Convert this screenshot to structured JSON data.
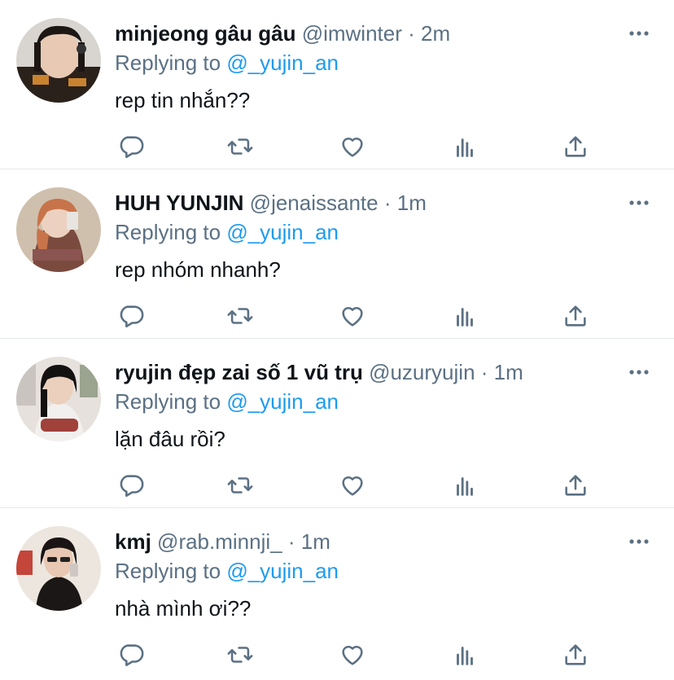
{
  "colors": {
    "accent": "#1d9bf0",
    "muted": "#5b7083",
    "text": "#0f1419",
    "divider": "#e6e9eb"
  },
  "icons": [
    "reply-icon",
    "retweet-icon",
    "like-icon",
    "analytics-icon",
    "share-icon",
    "more-icon"
  ],
  "tweets": [
    {
      "name": "minjeong gâu gâu",
      "handle": "@imwinter",
      "separator": "·",
      "time": "2m",
      "replying_prefix": "Replying to",
      "replying_to": "@_yujin_an",
      "text": "rep tin nhắn??"
    },
    {
      "name": "HUH YUNJIN",
      "handle": "@jenaissante",
      "separator": "·",
      "time": "1m",
      "replying_prefix": "Replying to",
      "replying_to": "@_yujin_an",
      "text": "rep nhóm nhanh?"
    },
    {
      "name": "ryujin đẹp zai số 1 vũ trụ",
      "handle": "@uzuryujin",
      "separator": "·",
      "time": "1m",
      "replying_prefix": "Replying to",
      "replying_to": "@_yujin_an",
      "text": "lặn đâu rồi?"
    },
    {
      "name": "kmj",
      "handle": "@rab.minnji_",
      "separator": "·",
      "time": "1m",
      "replying_prefix": "Replying to",
      "replying_to": "@_yujin_an",
      "text": "nhà mình ơi??"
    }
  ]
}
